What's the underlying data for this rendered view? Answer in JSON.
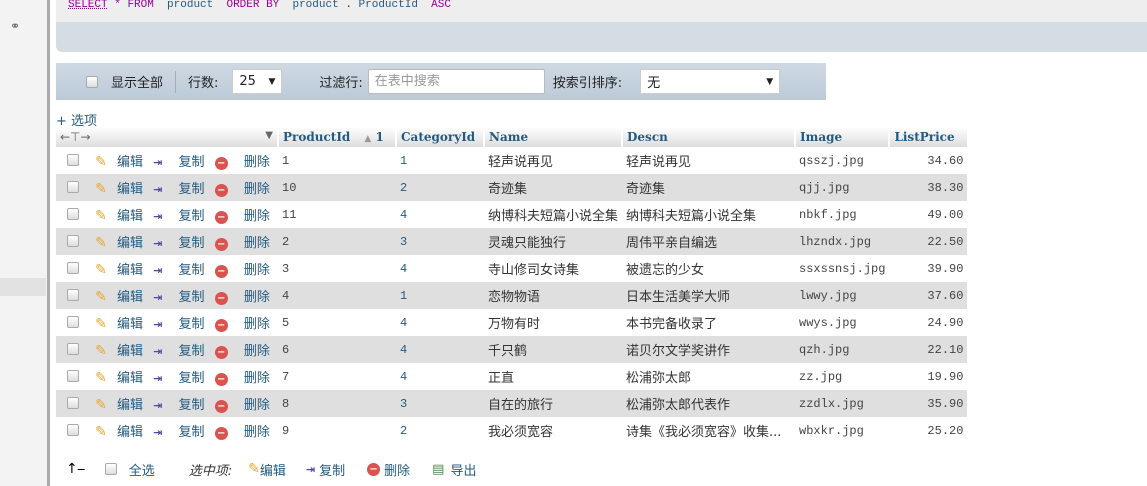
{
  "sql": {
    "select": "SELECT",
    "star": "*",
    "from": "FROM",
    "table": "product",
    "order": "ORDER BY",
    "table2": "product",
    "dot": ".",
    "col": "ProductId",
    "dir": "ASC"
  },
  "nav": {
    "show_all": "显示全部",
    "rows_label": "行数:",
    "rows_value": "25",
    "filter_label": "过滤行:",
    "filter_placeholder": "在表中搜索",
    "sort_label": "按索引排序:",
    "sort_value": "无"
  },
  "options_label": "+ 选项",
  "columns": [
    "ProductId",
    "CategoryId",
    "Name",
    "Descn",
    "Image",
    "ListPrice"
  ],
  "sort_indicator": "1",
  "actions": {
    "edit": "编辑",
    "copy": "复制",
    "delete": "删除"
  },
  "rows": [
    {
      "ProductId": "1",
      "CategoryId": "1",
      "Name": "轻声说再见",
      "Descn": "轻声说再见",
      "Image": "qsszj.jpg",
      "ListPrice": "34.60"
    },
    {
      "ProductId": "10",
      "CategoryId": "2",
      "Name": "奇迹集",
      "Descn": "奇迹集",
      "Image": "qjj.jpg",
      "ListPrice": "38.30"
    },
    {
      "ProductId": "11",
      "CategoryId": "4",
      "Name": "纳博科夫短篇小说全集",
      "Descn": "纳博科夫短篇小说全集",
      "Image": "nbkf.jpg",
      "ListPrice": "49.00"
    },
    {
      "ProductId": "2",
      "CategoryId": "3",
      "Name": "灵魂只能独行",
      "Descn": "周伟平亲自编选",
      "Image": "lhzndx.jpg",
      "ListPrice": "22.50"
    },
    {
      "ProductId": "3",
      "CategoryId": "4",
      "Name": "寺山修司女诗集",
      "Descn": "被遗忘的少女",
      "Image": "ssxssnsj.jpg",
      "ListPrice": "39.90"
    },
    {
      "ProductId": "4",
      "CategoryId": "1",
      "Name": "恋物物语",
      "Descn": "日本生活美学大师",
      "Image": "lwwy.jpg",
      "ListPrice": "37.60"
    },
    {
      "ProductId": "5",
      "CategoryId": "4",
      "Name": "万物有时",
      "Descn": "本书完备收录了",
      "Image": "wwys.jpg",
      "ListPrice": "24.90"
    },
    {
      "ProductId": "6",
      "CategoryId": "4",
      "Name": "千只鹤",
      "Descn": "诺贝尔文学奖讲作",
      "Image": "qzh.jpg",
      "ListPrice": "22.10"
    },
    {
      "ProductId": "7",
      "CategoryId": "4",
      "Name": "正直",
      "Descn": "松浦弥太郎",
      "Image": "zz.jpg",
      "ListPrice": "19.90"
    },
    {
      "ProductId": "8",
      "CategoryId": "3",
      "Name": "自在的旅行",
      "Descn": "松浦弥太郎代表作",
      "Image": "zzdlx.jpg",
      "ListPrice": "35.90"
    },
    {
      "ProductId": "9",
      "CategoryId": "2",
      "Name": "我必须宽容",
      "Descn": "诗集《我必须宽容》收集...",
      "Image": "wbxkr.jpg",
      "ListPrice": "25.20"
    }
  ],
  "footer": {
    "select_all": "全选",
    "with_selected": "选中项:",
    "edit": "编辑",
    "copy": "复制",
    "delete": "删除",
    "export": "导出"
  }
}
